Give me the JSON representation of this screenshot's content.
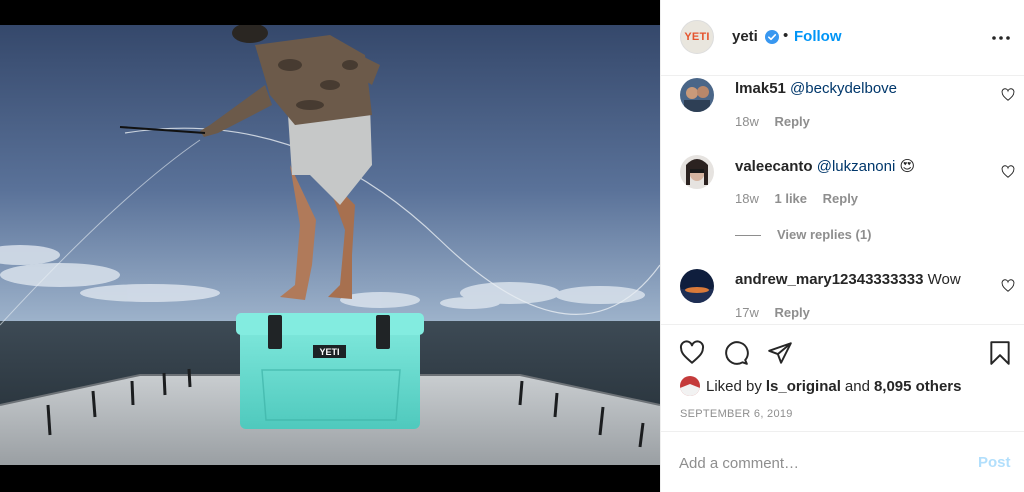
{
  "post_author": {
    "avatar_text": "YETI",
    "username": "yeti",
    "separator": "•",
    "follow_label": "Follow"
  },
  "comments": [
    {
      "username": "lmak51",
      "mention": "@beckydelbove",
      "text": "",
      "time": "18w",
      "likes": "",
      "reply_label": "Reply"
    },
    {
      "username": "valeecanto",
      "mention": "@lukzanoni",
      "text": "😍",
      "time": "18w",
      "likes": "1 like",
      "reply_label": "Reply",
      "view_replies": "View replies (1)"
    },
    {
      "username": "andrew_mary12343333333",
      "mention": "",
      "text": "Wow",
      "time": "17w",
      "likes": "",
      "reply_label": "Reply"
    }
  ],
  "likes": {
    "prefix": "Liked by",
    "user": "ls_original",
    "and": "and",
    "others": "8,095 others"
  },
  "post_date": "SEPTEMBER 6, 2019",
  "add_comment": {
    "placeholder": "Add a comment…",
    "post_label": "Post"
  },
  "photo": {
    "cooler_logo": "YETI"
  },
  "colors": {
    "link_blue": "#0095f6",
    "post_disabled": "#b2dffc",
    "secondary_text": "#8e8e8e",
    "cooler_seafoam": "#64dcd0",
    "yeti_orange": "#e5532d"
  }
}
